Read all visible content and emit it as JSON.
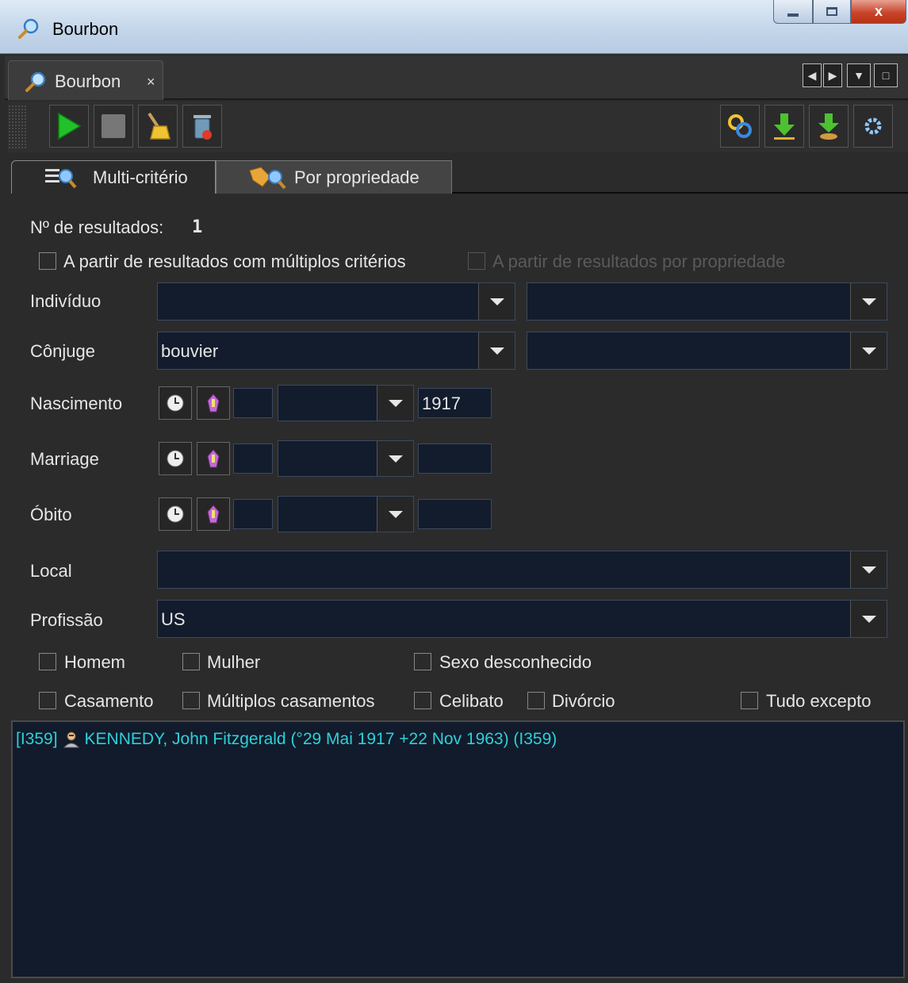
{
  "window": {
    "title": "Bourbon",
    "controls": {
      "minimize": "–",
      "maximize": "□",
      "close": "x"
    }
  },
  "dock": {
    "tab_label": "Bourbon",
    "tab_close": "×",
    "controls": {
      "prev": "◀",
      "next": "▶",
      "menu": "▼",
      "max": "□"
    }
  },
  "toolbar": {
    "left": [
      "run-icon",
      "stop-icon",
      "clean-icon",
      "delete-icon"
    ],
    "right": [
      "link-icon",
      "download-icon",
      "download-person-icon",
      "settings-icon"
    ]
  },
  "tabs": [
    {
      "label": "Multi-critério",
      "active": true
    },
    {
      "label": "Por propriedade",
      "active": false
    }
  ],
  "form": {
    "results_label": "Nº de resultados:",
    "results_count": "1",
    "from_multi_label": "A partir de resultados com múltiplos critérios",
    "from_property_label": "A partir de resultados por propriedade",
    "individual": {
      "label": "Indivíduo",
      "name": "",
      "firstname": ""
    },
    "spouse": {
      "label": "Cônjuge",
      "name": "bouvier",
      "firstname": ""
    },
    "birth": {
      "label": "Nascimento",
      "day": "",
      "month": "",
      "year": "1917"
    },
    "marriage": {
      "label": "Marriage",
      "day": "",
      "month": "",
      "year": ""
    },
    "death": {
      "label": "Óbito",
      "day": "",
      "month": "",
      "year": ""
    },
    "place": {
      "label": "Local",
      "value": ""
    },
    "occupation": {
      "label": "Profissão",
      "value": "US"
    },
    "sex": {
      "male": "Homem",
      "female": "Mulher",
      "unknown": "Sexo desconhecido"
    },
    "marital": {
      "married": "Casamento",
      "multiple": "Múltiplos casamentos",
      "single": "Celibato",
      "divorce": "Divórcio",
      "except_all": "Tudo excepto"
    }
  },
  "results": [
    {
      "id": "[I359]",
      "text": "KENNEDY, John Fitzgerald (°29 Mai 1917 +22 Nov 1963) (I359)"
    }
  ],
  "colors": {
    "result_text": "#2fd0d8",
    "field_bg": "#121c2c",
    "panel_bg": "#2b2b2b"
  }
}
